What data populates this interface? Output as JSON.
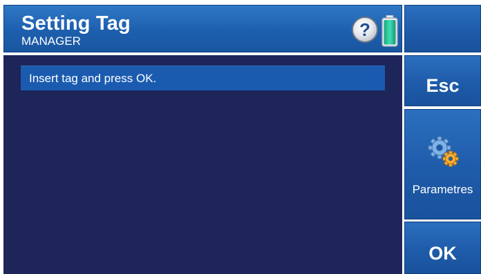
{
  "header": {
    "title": "Setting Tag",
    "subtitle": "MANAGER",
    "help_label": "?",
    "help_icon": "question-mark-icon",
    "battery_icon": "battery-icon"
  },
  "main": {
    "message": "Insert tag and press OK."
  },
  "sidebar": {
    "esc_label": "Esc",
    "params_label": "Parametres",
    "params_icon": "gears-icon",
    "ok_label": "OK"
  },
  "colors": {
    "header_blue": "#1d5fae",
    "main_bg": "#1e2558",
    "message_bar": "#1a5bb0",
    "battery_green": "#29c49a",
    "gear_blue": "#6aa4e0",
    "gear_orange": "#f2a11f"
  }
}
